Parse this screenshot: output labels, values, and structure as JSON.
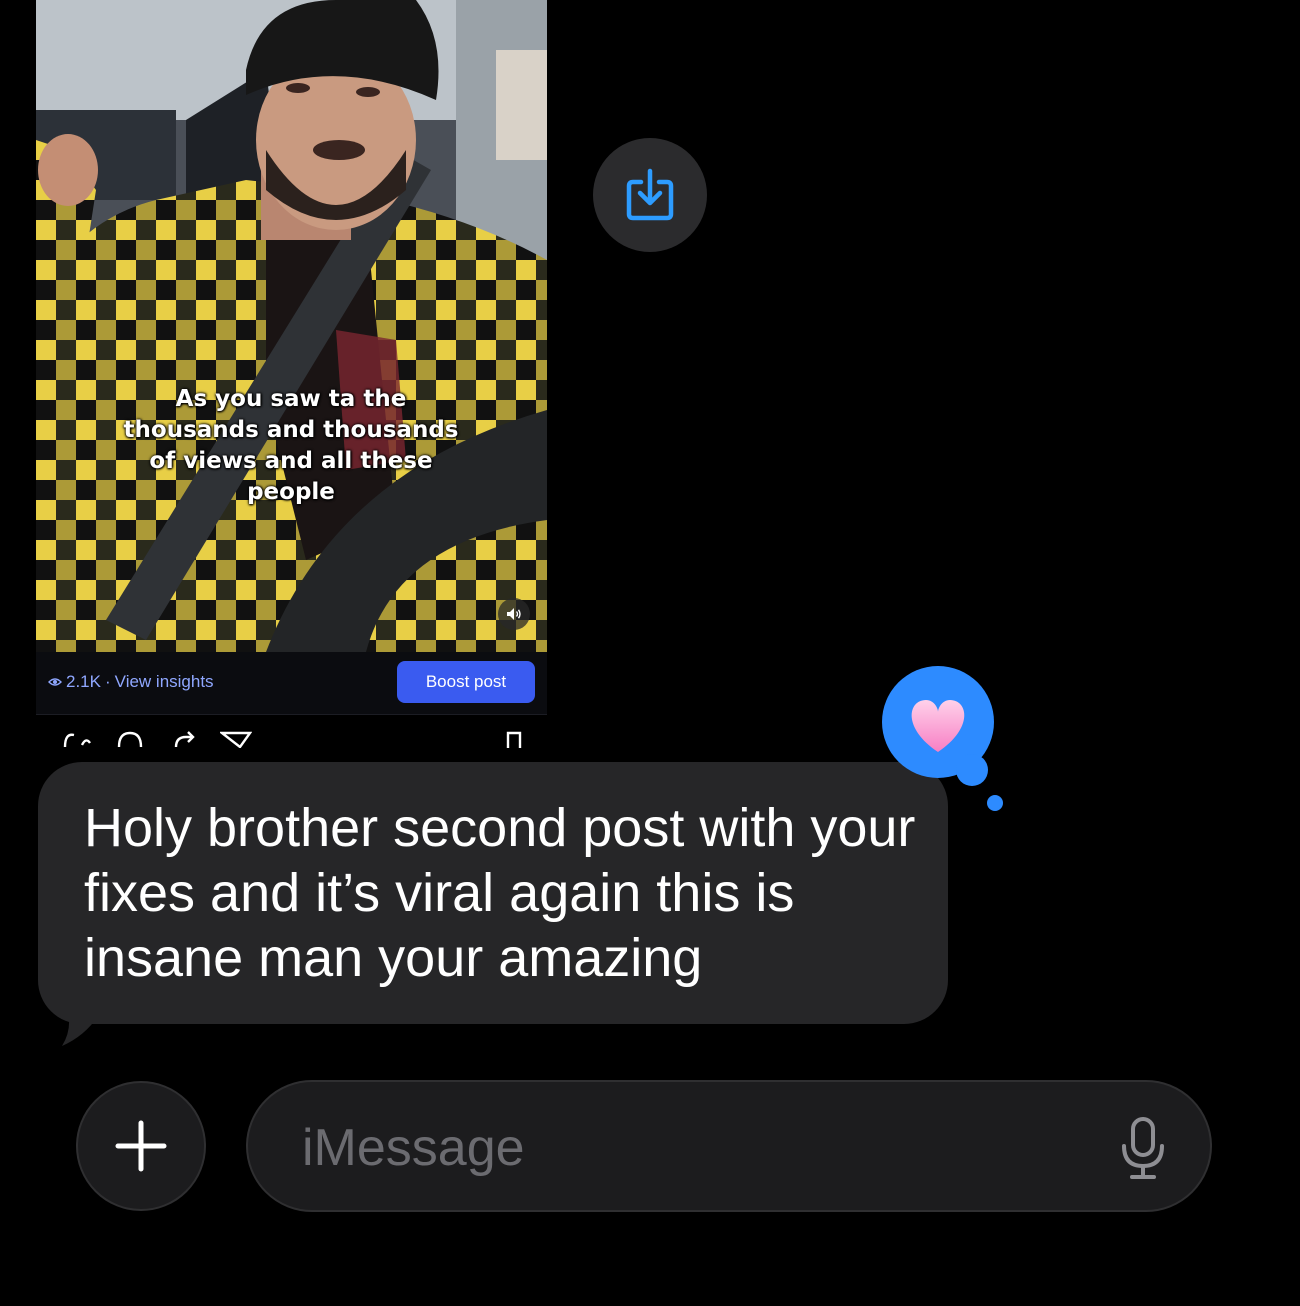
{
  "attachment": {
    "caption": "As you saw ta the\nthousands and thousands\nof views and all these\npeople",
    "views": "2.1K",
    "separator": " · ",
    "insights_label": "View insights",
    "boost_label": "Boost post",
    "volume_icon": "speaker-icon"
  },
  "save_button": {
    "icon": "save-to-photos-icon",
    "accent": "#2d9cff"
  },
  "message": {
    "text": "Holy brother second post with your fixes and it’s viral again this is insane man your amazing",
    "bubble_color": "#262628"
  },
  "tapback": {
    "reaction": "heart",
    "glyph": "♥",
    "color": "#2d8bff"
  },
  "composer": {
    "placeholder": "iMessage",
    "value": "",
    "plus_icon": "plus-icon",
    "mic_icon": "microphone-icon"
  }
}
